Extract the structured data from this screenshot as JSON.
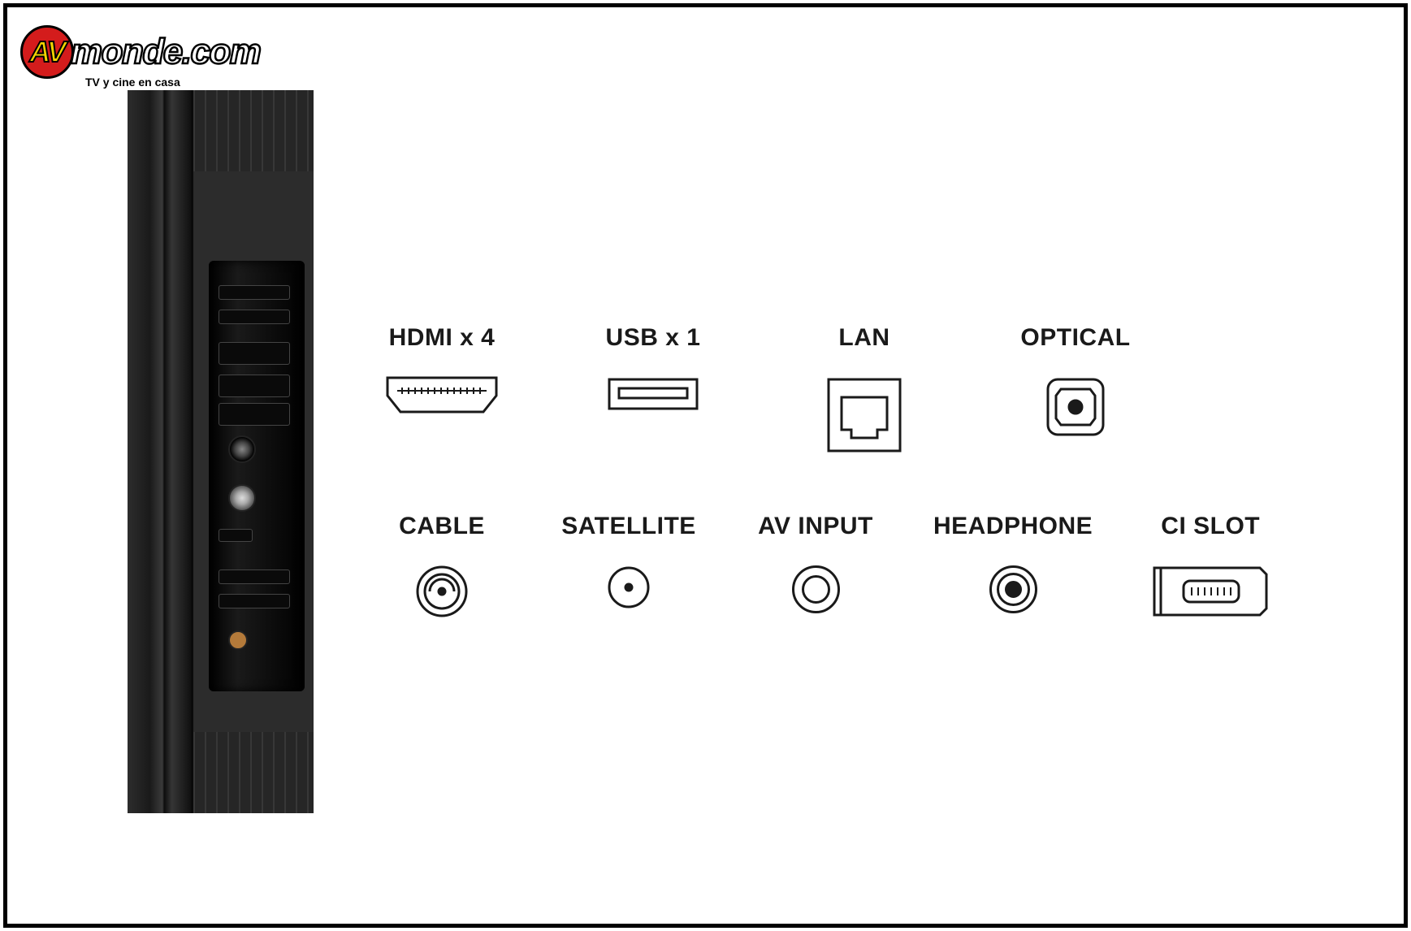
{
  "logo": {
    "badge": "AV",
    "text": "monde.com",
    "tagline": "TV y cine en casa"
  },
  "ports_row1": [
    {
      "label": "HDMI x 4",
      "name": "hdmi"
    },
    {
      "label": "USB x 1",
      "name": "usb"
    },
    {
      "label": "LAN",
      "name": "lan"
    },
    {
      "label": "OPTICAL",
      "name": "optical"
    }
  ],
  "ports_row2": [
    {
      "label": "CABLE",
      "name": "cable"
    },
    {
      "label": "SATELLITE",
      "name": "satellite"
    },
    {
      "label": "AV INPUT",
      "name": "av-input"
    },
    {
      "label": "HEADPHONE",
      "name": "headphone"
    },
    {
      "label": "CI SLOT",
      "name": "ci-slot"
    }
  ]
}
